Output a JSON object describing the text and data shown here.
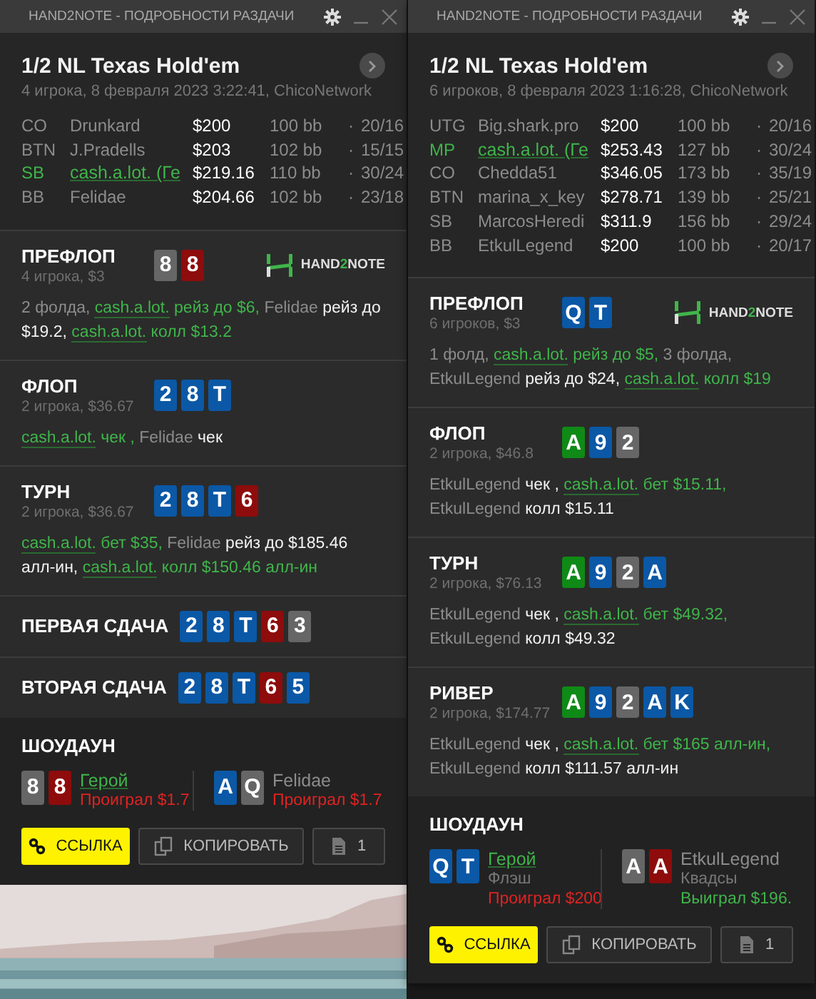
{
  "windows": [
    {
      "title": "HAND2NOTE - ПОДРОБНОСТИ РАЗДАЧИ",
      "game": "1/2 NL Texas Hold'em",
      "info": "4 игрока, 8 февраля 2023 3:22:41, ChicoNetwork",
      "players": [
        {
          "position": "CO",
          "name": "Drunkard",
          "stack": "$200",
          "bb": "100 bb",
          "sep": "·",
          "stats": "20/16",
          "hero": false
        },
        {
          "position": "BTN",
          "name": "J.Pradells",
          "stack": "$203",
          "bb": "102 bb",
          "sep": "·",
          "stats": "15/15",
          "hero": false
        },
        {
          "position": "SB",
          "name": "cash.a.lot. (Ге",
          "stack": "$219.16",
          "bb": "110 bb",
          "sep": "·",
          "stats": "30/24",
          "hero": true
        },
        {
          "position": "BB",
          "name": "Felidae",
          "stack": "$204.66",
          "bb": "102 bb",
          "sep": "·",
          "stats": "23/18",
          "hero": false
        }
      ],
      "streets": [
        {
          "name": "ПРЕФЛОП",
          "info": "4 игрока, $3",
          "logo": [
            "HAND",
            "2",
            "NOTE"
          ],
          "cards": [
            {
              "rank": "8",
              "color": "#666666"
            },
            {
              "rank": "8",
              "color": "#8e0c0c"
            }
          ],
          "actions": [
            {
              "kind": "plain",
              "text": "2 фолда, "
            },
            {
              "kind": "hero-name",
              "text": "cash.a.lot."
            },
            {
              "kind": "hero",
              "text": " рейз до $6,"
            },
            {
              "kind": "player",
              "text": " Felidae"
            },
            {
              "kind": "act",
              "text": " рейз до $19.2, "
            },
            {
              "kind": "hero-name",
              "text": "cash.a.lot."
            },
            {
              "kind": "hero",
              "text": " колл $13.2"
            }
          ]
        },
        {
          "name": "ФЛОП",
          "info": "2 игрока, $36.67",
          "cards": [
            {
              "rank": "2",
              "color": "#0b58a6"
            },
            {
              "rank": "8",
              "color": "#0b58a6"
            },
            {
              "rank": "T",
              "color": "#0b58a6"
            }
          ],
          "actions": [
            {
              "kind": "hero-name",
              "text": "cash.a.lot."
            },
            {
              "kind": "hero",
              "text": " чек ,"
            },
            {
              "kind": "player",
              "text": " Felidae"
            },
            {
              "kind": "act",
              "text": " чек"
            }
          ]
        },
        {
          "name": "ТУРН",
          "info": "2 игрока, $36.67",
          "cards": [
            {
              "rank": "2",
              "color": "#0b58a6"
            },
            {
              "rank": "8",
              "color": "#0b58a6"
            },
            {
              "rank": "T",
              "color": "#0b58a6"
            },
            {
              "rank": "6",
              "color": "#8e0c0c"
            }
          ],
          "actions": [
            {
              "kind": "hero-name",
              "text": "cash.a.lot."
            },
            {
              "kind": "hero",
              "text": " бет $35,"
            },
            {
              "kind": "player",
              "text": " Felidae"
            },
            {
              "kind": "act",
              "text": " рейз до $185.46 алл-ин, "
            },
            {
              "kind": "hero-name",
              "text": "cash.a.lot."
            },
            {
              "kind": "hero",
              "text": " колл $150.46 алл-ин"
            }
          ]
        },
        {
          "name": "ПЕРВАЯ СДАЧА",
          "cards": [
            {
              "rank": "2",
              "color": "#0b58a6"
            },
            {
              "rank": "8",
              "color": "#0b58a6"
            },
            {
              "rank": "T",
              "color": "#0b58a6"
            },
            {
              "rank": "6",
              "color": "#8e0c0c"
            },
            {
              "rank": "3",
              "color": "#666666"
            }
          ]
        },
        {
          "name": "ВТОРАЯ СДАЧА",
          "cards": [
            {
              "rank": "2",
              "color": "#0b58a6"
            },
            {
              "rank": "8",
              "color": "#0b58a6"
            },
            {
              "rank": "T",
              "color": "#0b58a6"
            },
            {
              "rank": "6",
              "color": "#8e0c0c"
            },
            {
              "rank": "5",
              "color": "#0b58a6"
            }
          ]
        }
      ],
      "showdown": {
        "title": "ШОУДАУН",
        "hands": [
          {
            "cards": [
              {
                "rank": "8",
                "color": "#666666"
              },
              {
                "rank": "8",
                "color": "#8e0c0c"
              }
            ],
            "name": "Герой",
            "hero": true,
            "result": "Проиграл $1.7",
            "won": false
          },
          {
            "cards": [
              {
                "rank": "A",
                "color": "#0b58a6"
              },
              {
                "rank": "Q",
                "color": "#666666"
              }
            ],
            "name": "Felidae",
            "hero": false,
            "result": "Проиграл $1.7",
            "won": false
          }
        ]
      },
      "buttons": [
        {
          "kind": "link",
          "label": "ССЫЛКА"
        },
        {
          "kind": "copy",
          "label": "КОПИРОВАТЬ"
        },
        {
          "kind": "count",
          "label": "1"
        }
      ]
    },
    {
      "title": "HAND2NOTE - ПОДРОБНОСТИ РАЗДАЧИ",
      "game": "1/2 NL Texas Hold'em",
      "info": "6 игроков, 8 февраля 2023 1:16:28, ChicoNetwork",
      "players": [
        {
          "position": "UTG",
          "name": "Big.shark.pro",
          "stack": "$200",
          "bb": "100 bb",
          "sep": "·",
          "stats": "20/16",
          "hero": false
        },
        {
          "position": "MP",
          "name": "cash.a.lot. (Ге",
          "stack": "$253.43",
          "bb": "127 bb",
          "sep": "·",
          "stats": "30/24",
          "hero": true
        },
        {
          "position": "CO",
          "name": "Chedda51",
          "stack": "$346.05",
          "bb": "173 bb",
          "sep": "·",
          "stats": "35/19",
          "hero": false
        },
        {
          "position": "BTN",
          "name": "marina_x_key",
          "stack": "$278.71",
          "bb": "139 bb",
          "sep": "·",
          "stats": "25/21",
          "hero": false
        },
        {
          "position": "SB",
          "name": "MarcosHeredi",
          "stack": "$311.9",
          "bb": "156 bb",
          "sep": "·",
          "stats": "29/24",
          "hero": false
        },
        {
          "position": "BB",
          "name": "EtkulLegend",
          "stack": "$200",
          "bb": "100 bb",
          "sep": "·",
          "stats": "20/17",
          "hero": false
        }
      ],
      "streets": [
        {
          "name": "ПРЕФЛОП",
          "info": "6 игроков, $3",
          "logo": [
            "HAND",
            "2",
            "NOTE"
          ],
          "cards": [
            {
              "rank": "Q",
              "color": "#0b58a6"
            },
            {
              "rank": "T",
              "color": "#0b58a6"
            }
          ],
          "actions": [
            {
              "kind": "plain",
              "text": "1 фолд, "
            },
            {
              "kind": "hero-name",
              "text": "cash.a.lot."
            },
            {
              "kind": "hero",
              "text": " рейз до $5,"
            },
            {
              "kind": "plain",
              "text": " 3 фолда, "
            },
            {
              "kind": "player",
              "text": "EtkulLegend"
            },
            {
              "kind": "act",
              "text": " рейз до $24, "
            },
            {
              "kind": "hero-name",
              "text": "cash.a.lot."
            },
            {
              "kind": "hero",
              "text": " колл $19"
            }
          ]
        },
        {
          "name": "ФЛОП",
          "info": "2 игрока, $46.8",
          "cards": [
            {
              "rank": "A",
              "color": "#0f8a16"
            },
            {
              "rank": "9",
              "color": "#0b58a6"
            },
            {
              "rank": "2",
              "color": "#666666"
            }
          ],
          "actions": [
            {
              "kind": "player",
              "text": "EtkulLegend"
            },
            {
              "kind": "act",
              "text": " чек , "
            },
            {
              "kind": "hero-name",
              "text": "cash.a.lot."
            },
            {
              "kind": "hero",
              "text": " бет $15.11,"
            },
            {
              "kind": "player",
              "text": " EtkulLegend"
            },
            {
              "kind": "act",
              "text": " колл $15.11"
            }
          ]
        },
        {
          "name": "ТУРН",
          "info": "2 игрока, $76.13",
          "cards": [
            {
              "rank": "A",
              "color": "#0f8a16"
            },
            {
              "rank": "9",
              "color": "#0b58a6"
            },
            {
              "rank": "2",
              "color": "#666666"
            },
            {
              "rank": "A",
              "color": "#0b58a6"
            }
          ],
          "actions": [
            {
              "kind": "player",
              "text": "EtkulLegend"
            },
            {
              "kind": "act",
              "text": " чек , "
            },
            {
              "kind": "hero-name",
              "text": "cash.a.lot."
            },
            {
              "kind": "hero",
              "text": " бет $49.32,"
            },
            {
              "kind": "player",
              "text": " EtkulLegend"
            },
            {
              "kind": "act",
              "text": " колл $49.32"
            }
          ]
        },
        {
          "name": "РИВЕР",
          "info": "2 игрока, $174.77",
          "cards": [
            {
              "rank": "A",
              "color": "#0f8a16"
            },
            {
              "rank": "9",
              "color": "#0b58a6"
            },
            {
              "rank": "2",
              "color": "#666666"
            },
            {
              "rank": "A",
              "color": "#0b58a6"
            },
            {
              "rank": "K",
              "color": "#0b58a6"
            }
          ],
          "actions": [
            {
              "kind": "player",
              "text": "EtkulLegend"
            },
            {
              "kind": "act",
              "text": " чек , "
            },
            {
              "kind": "hero-name",
              "text": "cash.a.lot."
            },
            {
              "kind": "hero",
              "text": " бет $165 алл-ин,"
            },
            {
              "kind": "player",
              "text": " EtkulLegend"
            },
            {
              "kind": "act",
              "text": " колл $111.57 алл-ин"
            }
          ]
        }
      ],
      "showdown": {
        "title": "ШОУДАУН",
        "hands": [
          {
            "cards": [
              {
                "rank": "Q",
                "color": "#0b58a6"
              },
              {
                "rank": "T",
                "color": "#0b58a6"
              }
            ],
            "name": "Герой",
            "hero": true,
            "hand": "Флэш",
            "result": "Проиграл $200",
            "won": false
          },
          {
            "cards": [
              {
                "rank": "A",
                "color": "#666666"
              },
              {
                "rank": "A",
                "color": "#8e0c0c"
              }
            ],
            "name": "EtkulLegend",
            "hero": false,
            "hand": "Квадсы",
            "result": "Выиграл $196.",
            "won": true
          }
        ]
      },
      "buttons": [
        {
          "kind": "link",
          "label": "ССЫЛКА"
        },
        {
          "kind": "copy",
          "label": "КОПИРОВАТЬ"
        },
        {
          "kind": "count",
          "label": "1"
        }
      ]
    }
  ]
}
